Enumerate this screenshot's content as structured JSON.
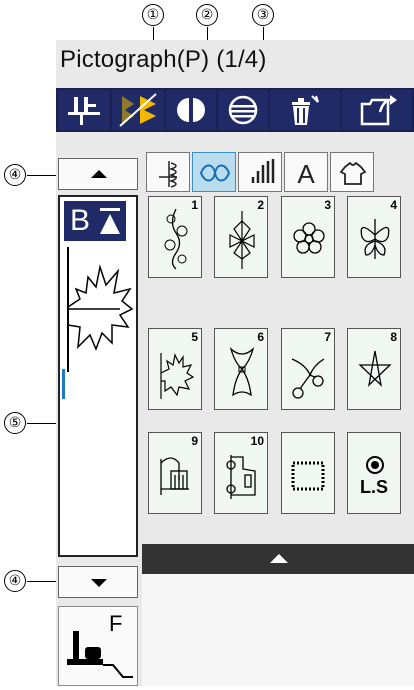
{
  "callouts": [
    "①",
    "②",
    "③",
    "④",
    "⑤",
    "④"
  ],
  "title": "Pictograph(P) (1/4)",
  "toolbar": {
    "icons": [
      "presser-foot-icon",
      "elongation-icon",
      "mirror-image-icon",
      "triple-stitch-icon",
      "delete-icon",
      "save-file-icon"
    ]
  },
  "left": {
    "bt_label": "B",
    "foot_label": "F"
  },
  "categories": {
    "letter_label": "A",
    "active_index": 1
  },
  "patterns": [
    {
      "num": "1",
      "icon": "floral-vine-icon"
    },
    {
      "num": "2",
      "icon": "snowflake-flower-icon"
    },
    {
      "num": "3",
      "icon": "flower-icon"
    },
    {
      "num": "4",
      "icon": "butterfly-icon"
    },
    {
      "num": "5",
      "icon": "maple-leaf-icon"
    },
    {
      "num": "6",
      "icon": "bow-icon"
    },
    {
      "num": "7",
      "icon": "cherries-icon"
    },
    {
      "num": "8",
      "icon": "star-icon"
    },
    {
      "num": "9",
      "icon": "house-icon"
    },
    {
      "num": "10",
      "icon": "car-icon"
    },
    {
      "num": "",
      "icon": "dotted-square-icon"
    },
    {
      "num": "",
      "icon": "locking-stitch-icon",
      "label": "L.S"
    }
  ]
}
